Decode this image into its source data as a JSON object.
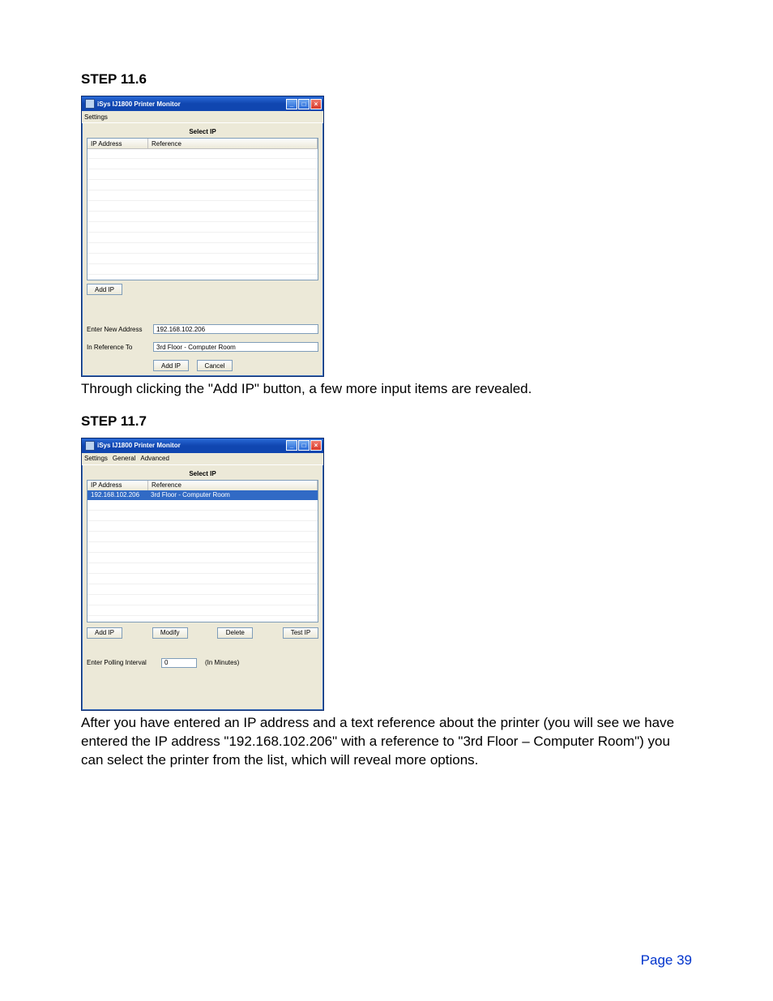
{
  "step1": {
    "heading": "STEP 11.6",
    "body": "Through clicking the \"Add IP\" button, a few more input items are revealed."
  },
  "step2": {
    "heading": "STEP 11.7",
    "body": "After you have entered an IP address and a text reference about the printer (you will see we have entered the IP address \"192.168.102.206\" with a reference to \"3rd Floor – Computer Room\") you can select the printer from the list, which will reveal more options."
  },
  "win1": {
    "title": "iSys IJ1800 Printer Monitor",
    "menu": {
      "settings": "Settings"
    },
    "section": "Select IP",
    "columns": {
      "ip": "IP Address",
      "ref": "Reference"
    },
    "add_ip_btn": "Add IP",
    "label_enter_new": "Enter New Address",
    "input_enter_new": "192.168.102.206",
    "label_ref_to": "In Reference To",
    "input_ref_to": "3rd Floor - Computer Room",
    "btn_add": "Add IP",
    "btn_cancel": "Cancel"
  },
  "win2": {
    "title": "iSys IJ1800 Printer Monitor",
    "menu": {
      "settings": "Settings",
      "general": "General",
      "advanced": "Advanced"
    },
    "section": "Select IP",
    "columns": {
      "ip": "IP Address",
      "ref": "Reference"
    },
    "row": {
      "ip": "192.168.102.206",
      "ref": "3rd Floor - Computer Room"
    },
    "btn_add": "Add IP",
    "btn_modify": "Modify",
    "btn_delete": "Delete",
    "btn_test": "Test IP",
    "label_polling": "Enter Polling Interval",
    "input_polling": "0",
    "unit_polling": "(In Minutes)"
  },
  "page_number": "Page 39"
}
